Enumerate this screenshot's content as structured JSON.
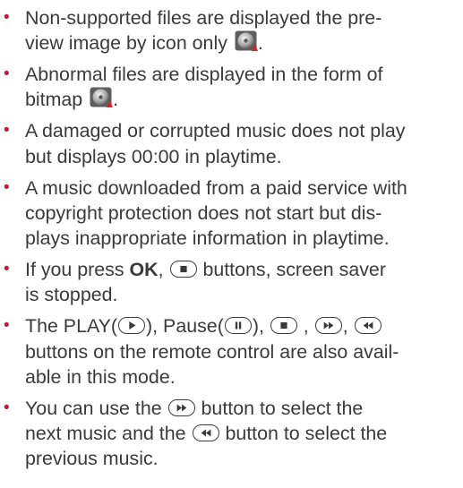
{
  "bullets": [
    {
      "lines": [
        "Non-supported files are displayed the pre-",
        "view image by icon only"
      ],
      "suffix": "."
    },
    {
      "lines": [
        "Abnormal files are displayed in the form of",
        "bitmap"
      ],
      "suffix": "."
    },
    {
      "lines": [
        "A damaged or corrupted music does not play",
        "but displays 00:00 in playtime."
      ]
    },
    {
      "lines": [
        "A music downloaded from a paid service with",
        "copyright protection does not start but dis-",
        "plays inappropriate information in playtime."
      ]
    },
    {
      "pre": "If you press ",
      "bold": "OK",
      "mid": ", ",
      "after": " buttons, screen saver",
      "line2": "is stopped."
    },
    {
      "p1": "The PLAY(",
      "p2": "), Pause(",
      "p3": "), ",
      "sep1": " , ",
      "sep2": ", ",
      "line2": "buttons on the remote control are also avail-",
      "line3": "able in this mode."
    },
    {
      "pre": "You can use the ",
      "post": " button to select the",
      "l2pre": "next music and the ",
      "l2post": " button to select the",
      "line3": "previous music."
    }
  ],
  "colors": {
    "bullet": "#c41a3a",
    "text": "#3a3a3a"
  },
  "icons": [
    "disc-thumbnail-icon",
    "play-button-icon",
    "pause-button-icon",
    "stop-button-icon",
    "fast-forward-button-icon",
    "rewind-button-icon"
  ]
}
